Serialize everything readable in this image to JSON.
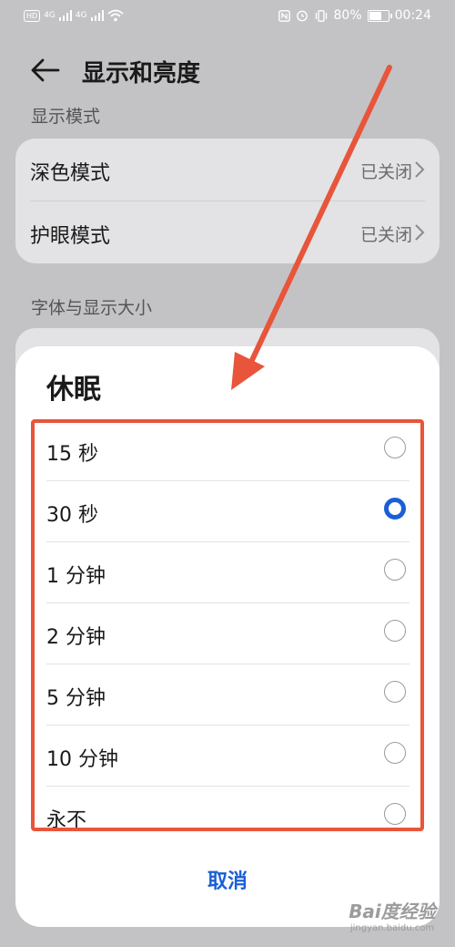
{
  "status_bar": {
    "sim_badge": "HD",
    "signal_1": "4G",
    "signal_2": "4G",
    "battery_percent": "80%",
    "battery_level": 0.8,
    "time": "00:24"
  },
  "header": {
    "title": "显示和亮度"
  },
  "sections": {
    "display_mode_label": "显示模式",
    "font_label": "字体与显示大小"
  },
  "settings": [
    {
      "label": "深色模式",
      "value": "已关闭"
    },
    {
      "label": "护眼模式",
      "value": "已关闭"
    }
  ],
  "dialog": {
    "title": "休眠",
    "selected_index": 1,
    "options": [
      "15 秒",
      "30 秒",
      "1 分钟",
      "2 分钟",
      "5 分钟",
      "10 分钟",
      "永不"
    ],
    "cancel_label": "取消"
  },
  "watermark": {
    "logo": "Bai度经验",
    "url": "jingyan.baidu.com"
  },
  "colors": {
    "accent": "#1a5fd6",
    "annotation": "#e8553b",
    "dim_background": "#c3c3c5"
  }
}
